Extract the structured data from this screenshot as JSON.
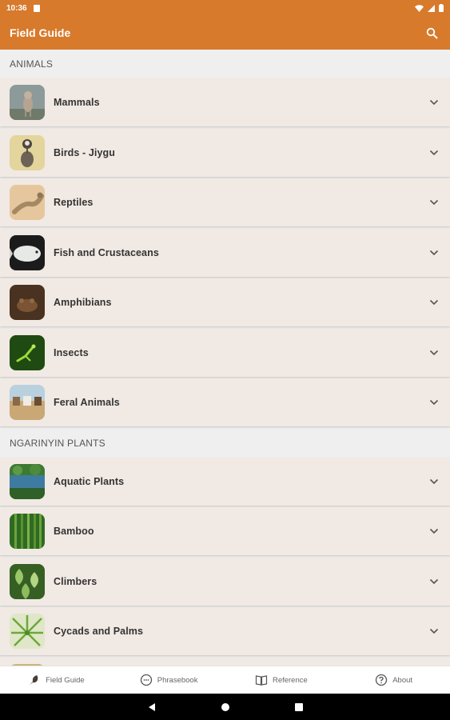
{
  "status_bar": {
    "time": "10:36"
  },
  "app_bar": {
    "title": "Field Guide"
  },
  "sections": [
    {
      "header": "ANIMALS",
      "items": [
        {
          "label": "Mammals",
          "icon": "mammal-thumbnail"
        },
        {
          "label": "Birds - Jiygu",
          "icon": "bird-thumbnail"
        },
        {
          "label": "Reptiles",
          "icon": "reptile-thumbnail"
        },
        {
          "label": "Fish and Crustaceans",
          "icon": "fish-thumbnail"
        },
        {
          "label": "Amphibians",
          "icon": "frog-thumbnail"
        },
        {
          "label": "Insects",
          "icon": "insect-thumbnail"
        },
        {
          "label": "Feral Animals",
          "icon": "feral-thumbnail"
        }
      ]
    },
    {
      "header": "NGARINYIN PLANTS",
      "items": [
        {
          "label": "Aquatic Plants",
          "icon": "aquatic-plant-thumbnail"
        },
        {
          "label": "Bamboo",
          "icon": "bamboo-thumbnail"
        },
        {
          "label": "Climbers",
          "icon": "climber-thumbnail"
        },
        {
          "label": "Cycads and Palms",
          "icon": "palm-thumbnail"
        }
      ]
    }
  ],
  "bottom_nav": [
    {
      "label": "Field Guide",
      "icon": "bird-icon",
      "active": true
    },
    {
      "label": "Phrasebook",
      "icon": "chat-bubble-icon",
      "active": false
    },
    {
      "label": "Reference",
      "icon": "book-icon",
      "active": false
    },
    {
      "label": "About",
      "icon": "help-circle-icon",
      "active": false
    }
  ],
  "colors": {
    "primary": "#d77a2c",
    "row_bg": "#f1e9e3",
    "page_bg": "#efefef",
    "nav_bg": "#ffffff"
  }
}
